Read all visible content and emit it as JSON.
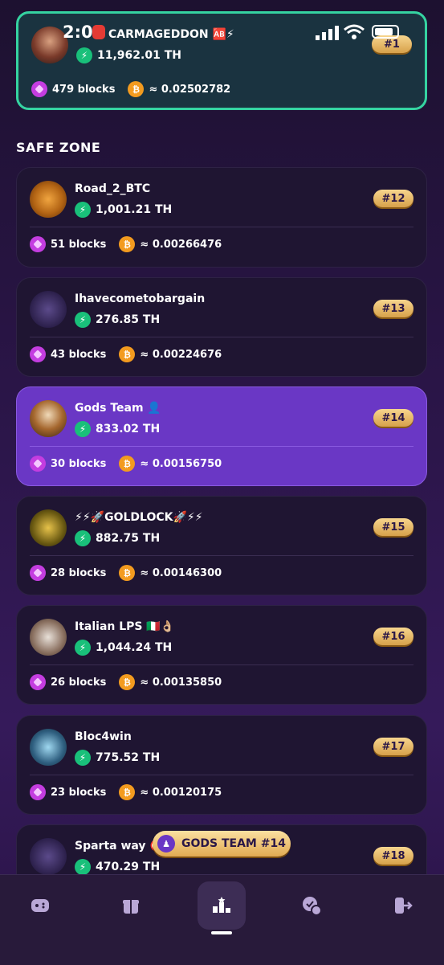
{
  "status_bar": {
    "time": "2:00"
  },
  "top_player": {
    "name": "CARMAGEDDON",
    "name_suffix": "🆎⚡",
    "hashrate": "11,962.01 TH",
    "blocks": "479 blocks",
    "btc": "≈ 0.02502782",
    "rank": "#1"
  },
  "section_title": "SAFE ZONE",
  "teams": [
    {
      "name": "Road_2_BTC",
      "hashrate": "1,001.21 TH",
      "blocks": "51 blocks",
      "btc": "≈ 0.00266476",
      "rank": "#12"
    },
    {
      "name": "Ihavecometobargain",
      "hashrate": "276.85 TH",
      "blocks": "43 blocks",
      "btc": "≈ 0.00224676",
      "rank": "#13"
    },
    {
      "name": "Gods Team 👤",
      "hashrate": "833.02 TH",
      "blocks": "30 blocks",
      "btc": "≈ 0.00156750",
      "rank": "#14"
    },
    {
      "name": "⚡⚡🚀GOLDLOCK🚀⚡⚡",
      "hashrate": "882.75 TH",
      "blocks": "28 blocks",
      "btc": "≈ 0.00146300",
      "rank": "#15"
    },
    {
      "name": "Italian LPS 🇮🇹👌🏼",
      "hashrate": "1,044.24 TH",
      "blocks": "26 blocks",
      "btc": "≈ 0.00135850",
      "rank": "#16"
    },
    {
      "name": "Bloc4win",
      "hashrate": "775.52 TH",
      "blocks": "23 blocks",
      "btc": "≈ 0.00120175",
      "rank": "#17"
    },
    {
      "name": "Sparta way 🎯",
      "hashrate": "470.29 TH",
      "blocks": "",
      "btc": "",
      "rank": "#18"
    }
  ],
  "my_team_pill": "GODS TEAM #14",
  "nav": {
    "items": [
      "games-icon",
      "gift-icon",
      "leaderboard-icon",
      "tasks-icon",
      "exit-icon"
    ]
  }
}
